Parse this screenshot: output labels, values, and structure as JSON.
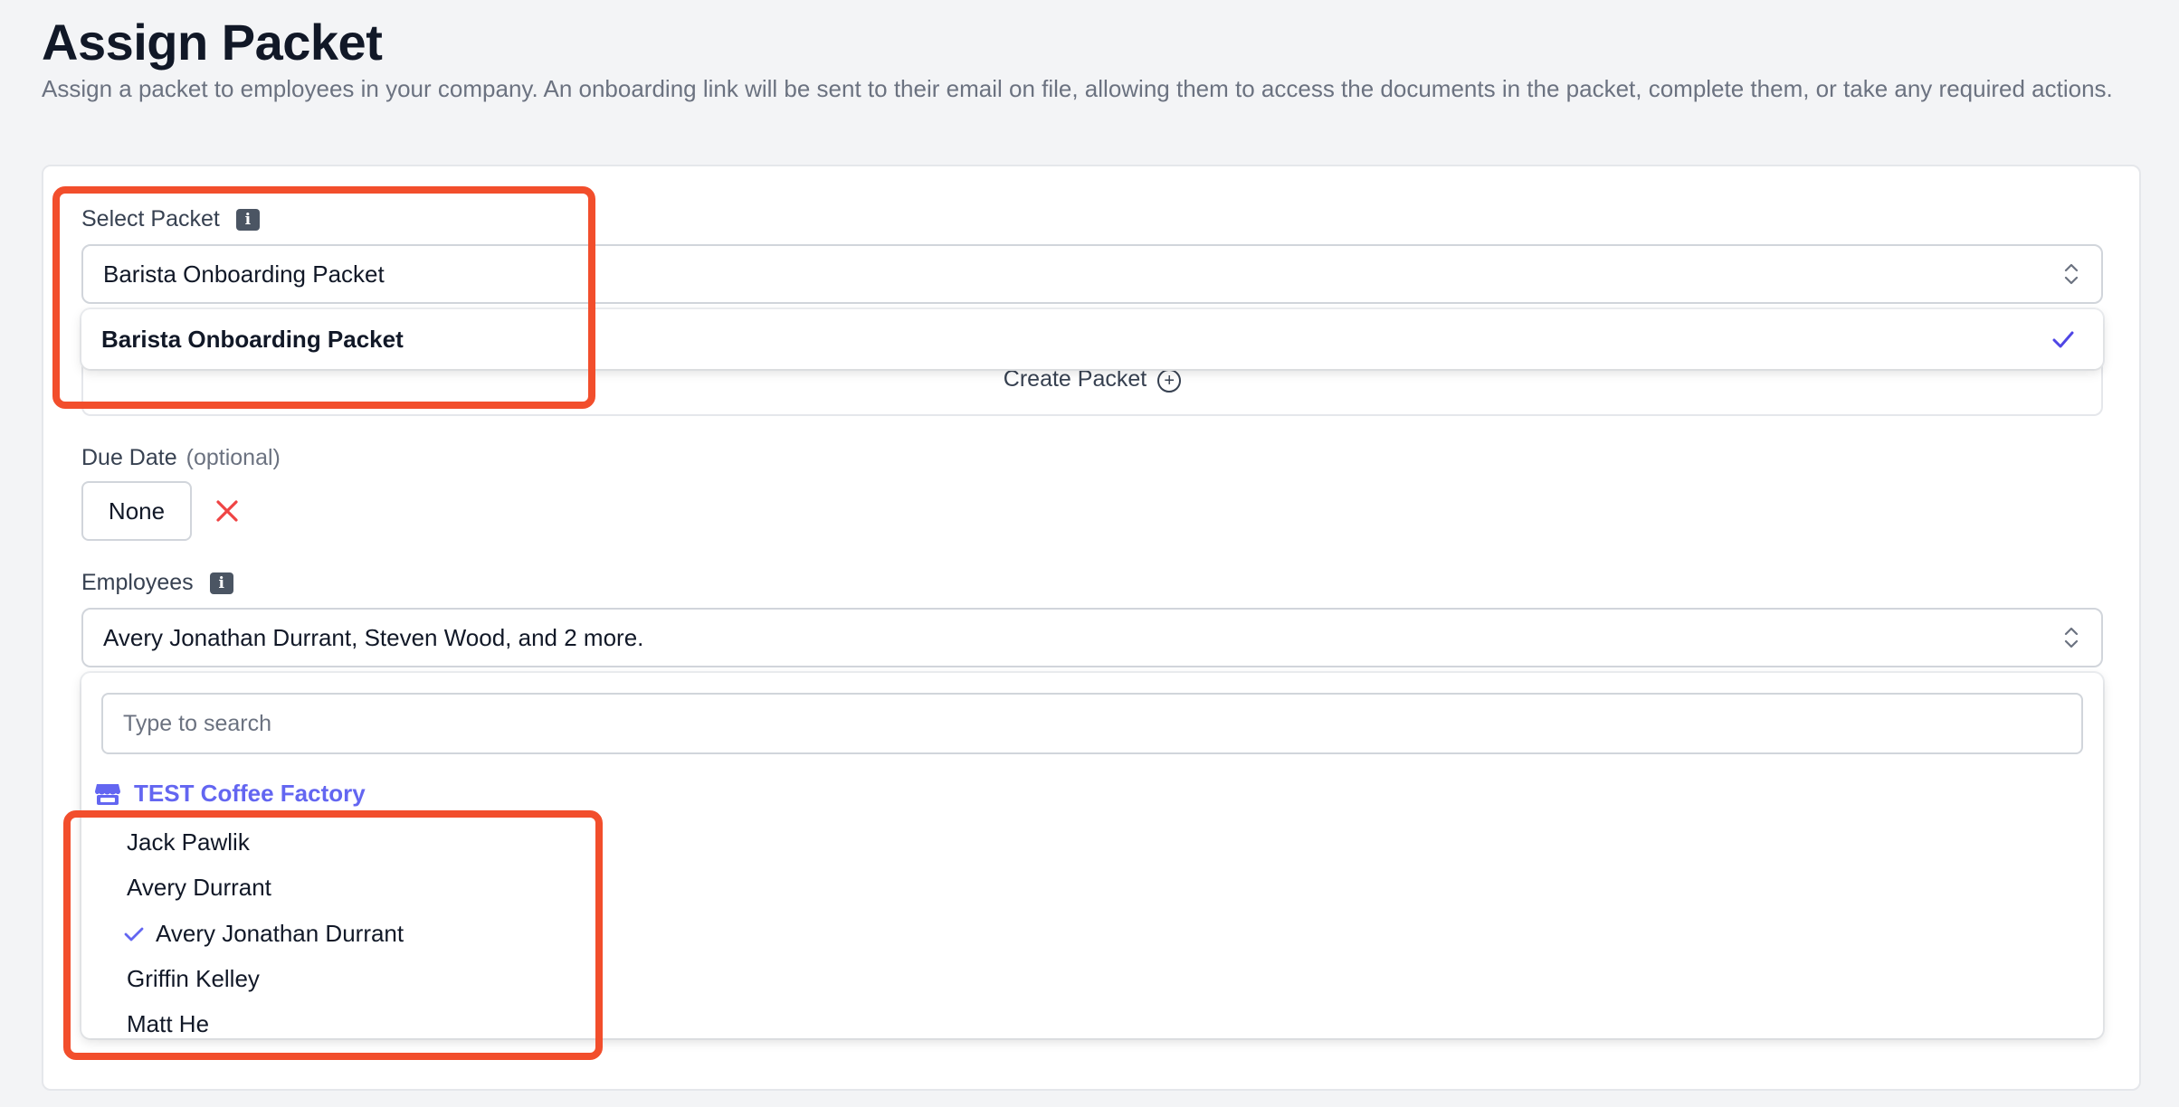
{
  "header": {
    "title": "Assign Packet",
    "subtitle": "Assign a packet to employees in your company. An onboarding link will be sent to their email on file, allowing them to access the documents in the packet, complete them, or take any required actions."
  },
  "packet": {
    "label": "Select Packet",
    "info_icon": "info-icon",
    "selected_value": "Barista Onboarding Packet",
    "options": [
      {
        "label": "Barista Onboarding Packet",
        "selected": true
      }
    ],
    "create_label": "Create Packet"
  },
  "due_date": {
    "label": "Due Date",
    "optional_label": "(optional)",
    "value": "None",
    "clear_icon": "close-icon"
  },
  "employees": {
    "label": "Employees",
    "info_icon": "info-icon",
    "selected_value": "Avery Jonathan Durrant, Steven Wood, and 2 more.",
    "search_placeholder": "Type to search",
    "group": "TEST Coffee Factory",
    "group_icon": "store-icon",
    "items": [
      {
        "name": "Jack Pawlik",
        "selected": false
      },
      {
        "name": "Avery Durrant",
        "selected": false
      },
      {
        "name": "Avery Jonathan Durrant",
        "selected": true
      },
      {
        "name": "Griffin Kelley",
        "selected": false
      },
      {
        "name": "Matt He",
        "selected": false
      }
    ]
  },
  "colors": {
    "accent": "#6366f1",
    "check": "#4f46e5",
    "danger": "#ef4444",
    "highlight": "#f24e2c",
    "background": "#f3f4f6"
  }
}
